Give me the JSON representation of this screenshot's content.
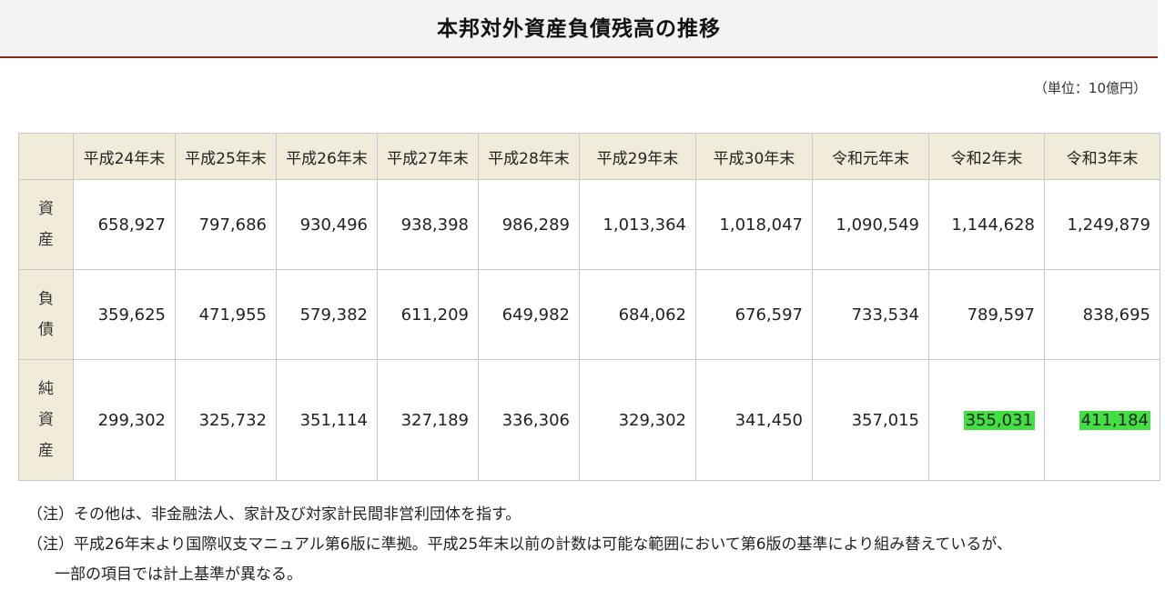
{
  "title": "本邦対外資産負債残高の推移",
  "unit": "（単位：10億円）",
  "columns": [
    "平成24年末",
    "平成25年末",
    "平成26年末",
    "平成27年末",
    "平成28年末",
    "平成29年末",
    "平成30年末",
    "令和元年末",
    "令和2年末",
    "令和3年末"
  ],
  "rows": [
    {
      "label": "資産",
      "values": [
        "658,927",
        "797,686",
        "930,496",
        "938,398",
        "986,289",
        "1,013,364",
        "1,018,047",
        "1,090,549",
        "1,144,628",
        "1,249,879"
      ]
    },
    {
      "label": "負債",
      "values": [
        "359,625",
        "471,955",
        "579,382",
        "611,209",
        "649,982",
        "684,062",
        "676,597",
        "733,534",
        "789,597",
        "838,695"
      ]
    },
    {
      "label": "純資産",
      "values": [
        "299,302",
        "325,732",
        "351,114",
        "327,189",
        "336,306",
        "329,302",
        "341,450",
        "357,015",
        "355,031",
        "411,184"
      ]
    }
  ],
  "highlight_color": "#3fe03f",
  "notes": {
    "note1": "（注）その他は、非金融法人、家計及び対家計民間非営利団体を指す。",
    "note2": "（注）平成26年末より国際収支マニュアル第6版に準拠。平成25年末以前の計数は可能な範囲において第6版の基準により組み替えているが、",
    "note2_cont": "一部の項目では計上基準が異なる。"
  }
}
